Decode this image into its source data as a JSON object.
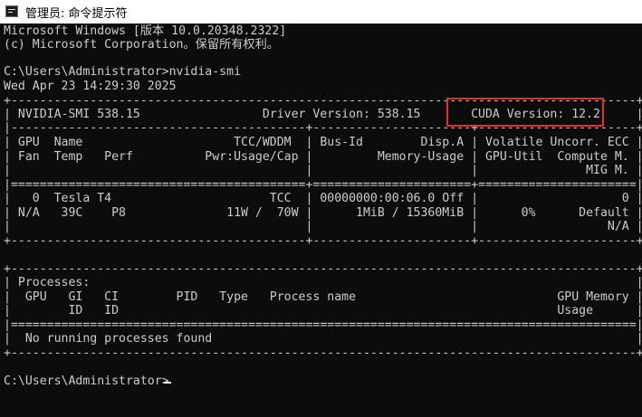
{
  "window": {
    "title": "管理员: 命令提示符",
    "icon": "cmd-console-icon"
  },
  "console": {
    "lines": [
      "Microsoft Windows [版本 10.0.20348.2322]",
      "(c) Microsoft Corporation。保留所有权利。",
      "",
      "C:\\Users\\Administrator>nvidia-smi",
      "Wed Apr 23 14:29:30 2025",
      "+---------------------------------------------------------------------------------------+",
      "| NVIDIA-SMI 538.15                 Driver Version: 538.15       CUDA Version: 12.2     |",
      "|-----------------------------------------+----------------------+----------------------+",
      "| GPU  Name                     TCC/WDDM  | Bus-Id        Disp.A | Volatile Uncorr. ECC |",
      "| Fan  Temp   Perf          Pwr:Usage/Cap |         Memory-Usage | GPU-Util  Compute M. |",
      "|                                         |                      |               MIG M. |",
      "|=========================================+======================+======================|",
      "|   0  Tesla T4                      TCC  | 00000000:00:06.0 Off |                    0 |",
      "| N/A   39C    P8              11W /  70W |      1MiB / 15360MiB |      0%      Default |",
      "|                                         |                      |                  N/A |",
      "+-----------------------------------------+----------------------+----------------------+",
      "",
      "+---------------------------------------------------------------------------------------+",
      "| Processes:                                                                            |",
      "|  GPU   GI   CI        PID   Type   Process name                            GPU Memory |",
      "|        ID   ID                                                             Usage      |",
      "|=======================================================================================|",
      "|  No running processes found                                                           |",
      "+---------------------------------------------------------------------------------------+",
      "",
      "C:\\Users\\Administrator>"
    ]
  },
  "colors": {
    "background": "#0c0c0c",
    "text": "#cccccc",
    "highlight_box": "#e0312a"
  }
}
